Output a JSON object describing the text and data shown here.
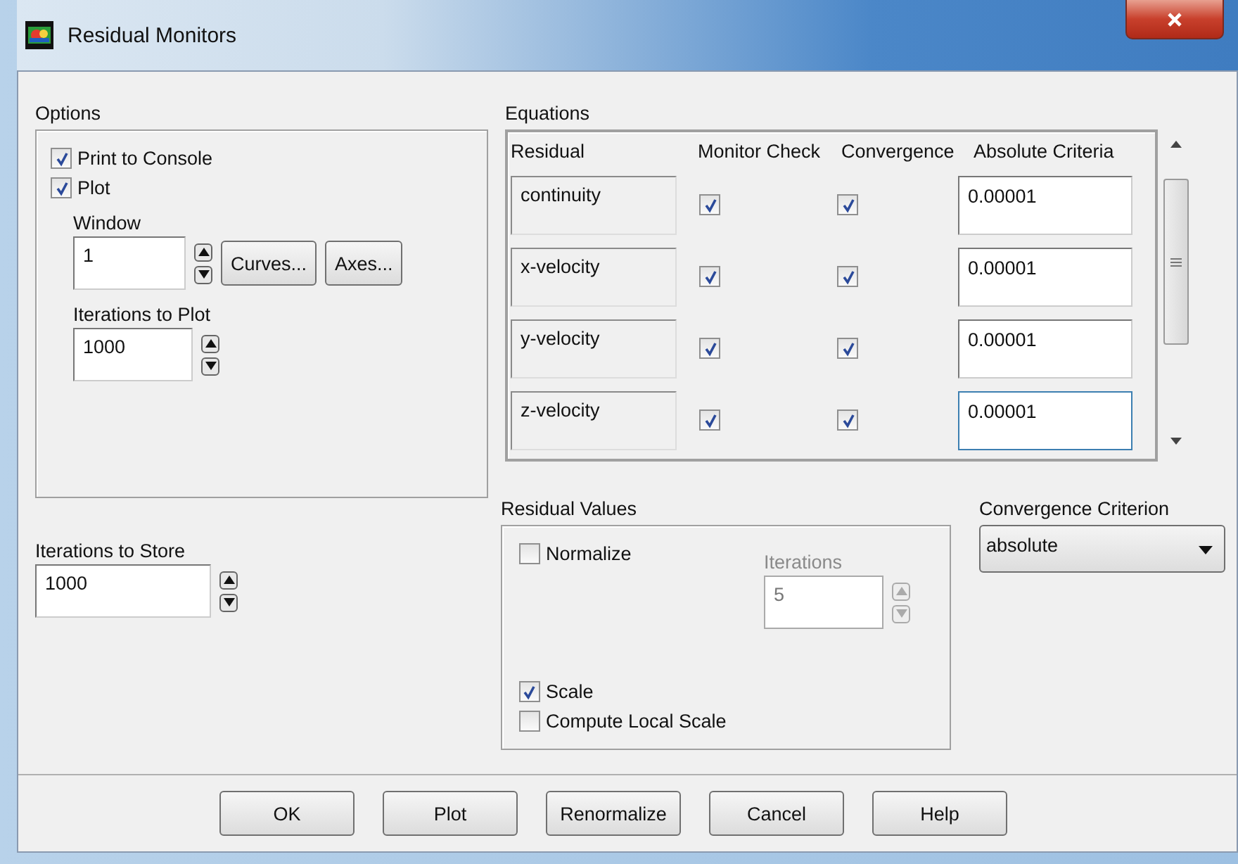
{
  "window": {
    "title": "Residual Monitors"
  },
  "options": {
    "label": "Options",
    "checks": [
      {
        "label": "Print to Console",
        "checked": true
      },
      {
        "label": "Plot",
        "checked": true
      }
    ],
    "window_field": {
      "label": "Window",
      "value": "1"
    },
    "buttons": [
      "Curves...",
      "Axes..."
    ],
    "iterations_to_plot": {
      "label": "Iterations to Plot",
      "value": "1000"
    }
  },
  "iterations_to_store": {
    "label": "Iterations to Store",
    "value": "1000"
  },
  "equations": {
    "label": "Equations",
    "columns": [
      "Residual",
      "Monitor Check",
      "Convergence",
      "Absolute Criteria"
    ],
    "rows": [
      {
        "residual": "continuity",
        "monitor": true,
        "convergence": true,
        "criteria": "0.00001",
        "focused": false
      },
      {
        "residual": "x-velocity",
        "monitor": true,
        "convergence": true,
        "criteria": "0.00001",
        "focused": false
      },
      {
        "residual": "y-velocity",
        "monitor": true,
        "convergence": true,
        "criteria": "0.00001",
        "focused": false
      },
      {
        "residual": "z-velocity",
        "monitor": true,
        "convergence": true,
        "criteria": "0.00001",
        "focused": true
      }
    ]
  },
  "residual_values": {
    "label": "Residual Values",
    "normalize": {
      "label": "Normalize",
      "checked": false
    },
    "iterations": {
      "label": "Iterations",
      "value": "5",
      "disabled": true
    },
    "scale": {
      "label": "Scale",
      "checked": true
    },
    "local_scale": {
      "label": "Compute Local Scale",
      "checked": false
    }
  },
  "convergence_criterion": {
    "label": "Convergence Criterion",
    "value": "absolute"
  },
  "buttons": [
    "OK",
    "Plot",
    "Renormalize",
    "Cancel",
    "Help"
  ]
}
